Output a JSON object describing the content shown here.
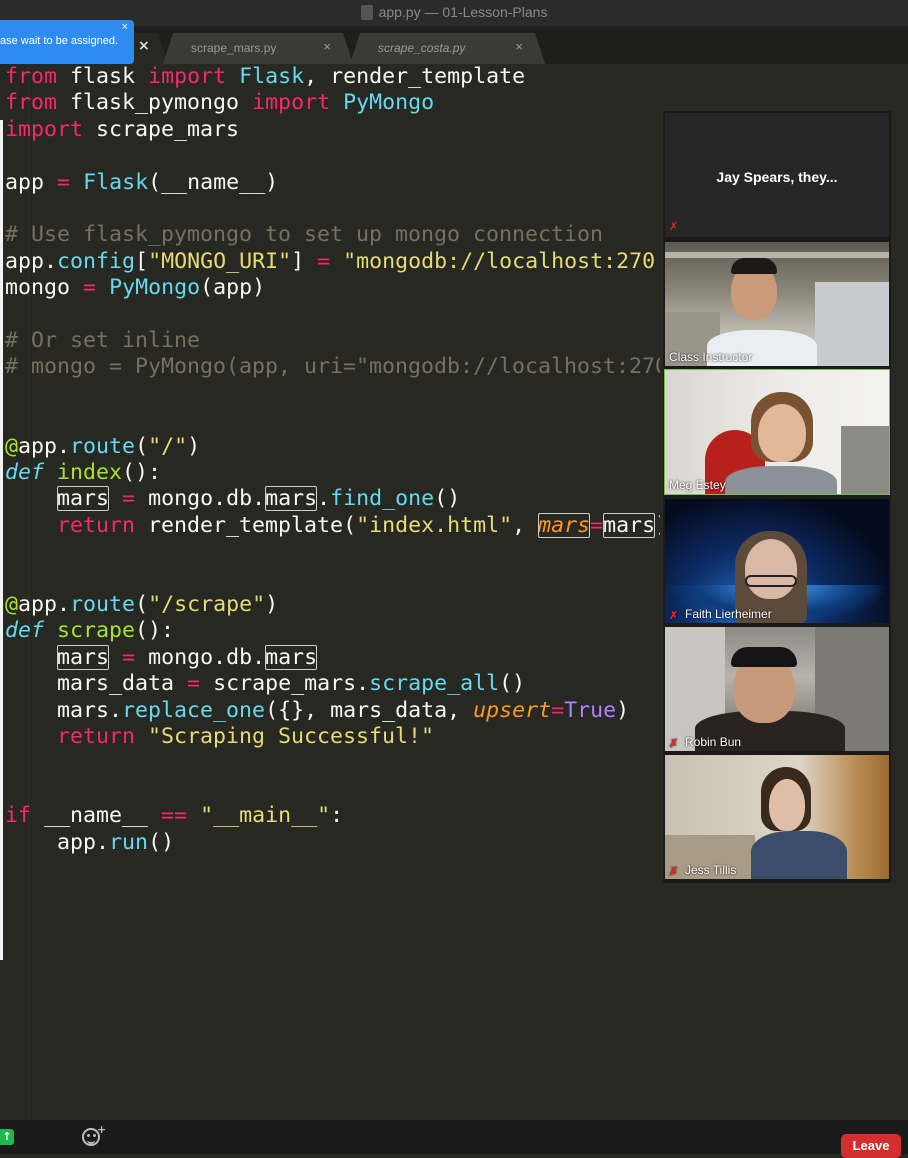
{
  "window": {
    "title": "app.py — 01-Lesson-Plans"
  },
  "notification": {
    "message": "ase wait to be assigned.",
    "close": "×"
  },
  "tabs": [
    {
      "label": "",
      "close": "×"
    },
    {
      "label": "scrape_mars.py",
      "close": "×"
    },
    {
      "label": "scrape_costa.py",
      "close": "×"
    }
  ],
  "code_lines": [
    "from flask import Flask, render_template",
    "from flask_pymongo import PyMongo",
    "import scrape_mars",
    "",
    "app = Flask(__name__)",
    "",
    "# Use flask_pymongo to set up mongo connection",
    "app.config[\"MONGO_URI\"] = \"mongodb://localhost:270",
    "mongo = PyMongo(app)",
    "",
    "# Or set inline",
    "# mongo = PyMongo(app, uri=\"mongodb://localhost:270",
    "",
    "",
    "@app.route(\"/\")",
    "def index():",
    "    mars = mongo.db.mars.find_one()",
    "    return render_template(\"index.html\", mars=mars)",
    "",
    "",
    "@app.route(\"/scrape\")",
    "def scrape():",
    "    mars = mongo.db.mars",
    "    mars_data = scrape_mars.scrape_all()",
    "    mars.replace_one({}, mars_data, upsert=True)",
    "    return \"Scraping Successful!\"",
    "",
    "",
    "if __name__ == \"__main__\":",
    "    app.run()"
  ],
  "participants": [
    {
      "name": "Jay Spears, they...",
      "muted": true,
      "video": false
    },
    {
      "name": "Class Instructor",
      "muted": false,
      "video": true
    },
    {
      "name": "Meg Estey",
      "muted": false,
      "video": true,
      "speaking": true
    },
    {
      "name": "Faith Lierheimer",
      "muted": true,
      "video": true
    },
    {
      "name": "Robin Bun",
      "muted": true,
      "video": true
    },
    {
      "name": "Jess Tillis",
      "muted": true,
      "video": true
    }
  ],
  "controls": {
    "leave_label": "Leave",
    "share_icon": "arrow-up-icon",
    "reaction_icon": "emoji-add-icon",
    "react_plus": "+",
    "share_glyph": "↑"
  },
  "colors": {
    "editor_bg": "#272822",
    "keyword": "#f92672",
    "function": "#66d9ef",
    "name": "#a6e22e",
    "string": "#e6db74",
    "comment": "#75715e",
    "constant": "#ae81ff",
    "leave": "#d32f2f",
    "speaking_border": "#7ac142",
    "notification": "#2e8cf0"
  }
}
